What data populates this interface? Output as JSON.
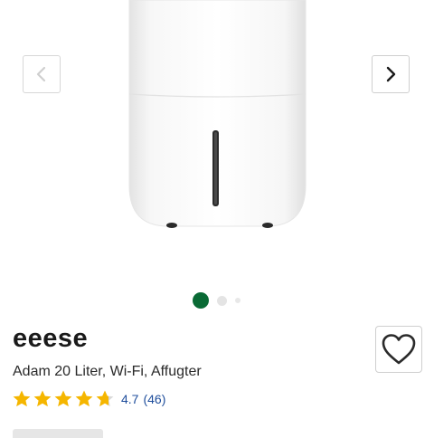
{
  "product": {
    "brand": "eeese",
    "title": "Adam 20 Liter, Wi-Fi, Affugter",
    "rating": "4.7",
    "reviews": "(46)",
    "rating_stars": 4.7
  },
  "gallery": {
    "image_icon": "dehumidifier-product-photo",
    "prev_icon": "chevron-left-icon",
    "next_icon": "chevron-right-icon",
    "slide_count": 3,
    "active_slide": 1
  },
  "colors": {
    "accent_green": "#0a6a35",
    "star_yellow": "#f5b600",
    "link_blue": "#1f4e9c"
  }
}
